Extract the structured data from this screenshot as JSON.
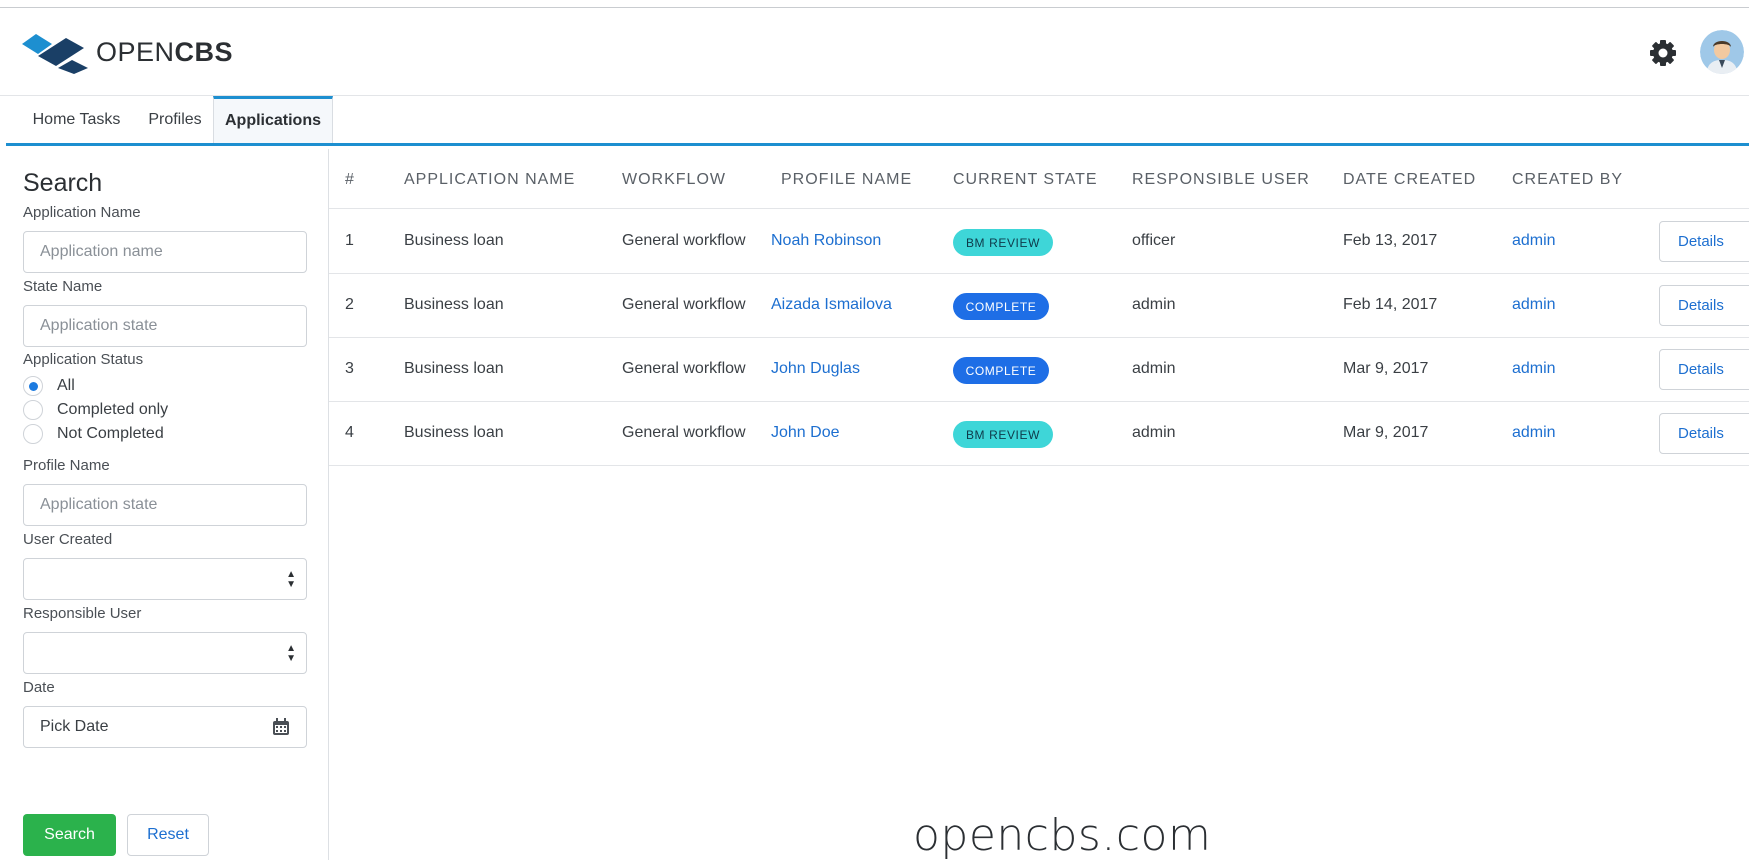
{
  "brand": {
    "logo_prefix": "OPEN",
    "logo_suffix": "CBS",
    "accent": "#1d8fd0"
  },
  "header": {
    "settings_icon": "gear-icon",
    "avatar_icon": "user-avatar"
  },
  "tabs": [
    {
      "label": "Home Tasks",
      "active": false
    },
    {
      "label": "Profiles",
      "active": false
    },
    {
      "label": "Applications",
      "active": true
    }
  ],
  "search": {
    "title": "Search",
    "application_name": {
      "label": "Application Name",
      "placeholder": "Application name",
      "value": ""
    },
    "state_name": {
      "label": "State Name",
      "placeholder": "Application state",
      "value": ""
    },
    "application_status": {
      "label": "Application Status",
      "options": [
        "All",
        "Completed only",
        "Not Completed"
      ],
      "selected": "All"
    },
    "profile_name": {
      "label": "Profile Name",
      "placeholder": "Application state",
      "value": ""
    },
    "user_created": {
      "label": "User Created",
      "value": ""
    },
    "responsible_user": {
      "label": "Responsible User",
      "value": ""
    },
    "date": {
      "label": "Date",
      "value": "Pick Date"
    },
    "search_button": "Search",
    "reset_button": "Reset"
  },
  "table": {
    "columns": [
      "#",
      "APPLICATION NAME",
      "WORKFLOW",
      "PROFILE NAME",
      "CURRENT STATE",
      "RESPONSIBLE USER",
      "DATE CREATED",
      "CREATED BY"
    ],
    "rows": [
      {
        "num": "1",
        "app": "Business loan",
        "workflow": "General workflow",
        "profile": "Noah Robinson",
        "state": "BM REVIEW",
        "responsible": "officer",
        "date": "Feb 13, 2017",
        "created_by": "admin",
        "action": "Details"
      },
      {
        "num": "2",
        "app": "Business loan",
        "workflow": "General workflow",
        "profile": "Aizada Ismailova",
        "state": "COMPLETE",
        "responsible": "admin",
        "date": "Feb 14, 2017",
        "created_by": "admin",
        "action": "Details"
      },
      {
        "num": "3",
        "app": "Business loan",
        "workflow": "General workflow",
        "profile": "John Duglas",
        "state": "COMPLETE",
        "responsible": "admin",
        "date": "Mar 9, 2017",
        "created_by": "admin",
        "action": "Details"
      },
      {
        "num": "4",
        "app": "Business loan",
        "workflow": "General workflow",
        "profile": "John Doe",
        "state": "BM REVIEW",
        "responsible": "admin",
        "date": "Mar 9, 2017",
        "created_by": "admin",
        "action": "Details"
      }
    ],
    "state_colors": {
      "BM REVIEW": "#3ed6d8",
      "COMPLETE": "#1e6ee6"
    }
  },
  "watermark": "opencbs.com"
}
